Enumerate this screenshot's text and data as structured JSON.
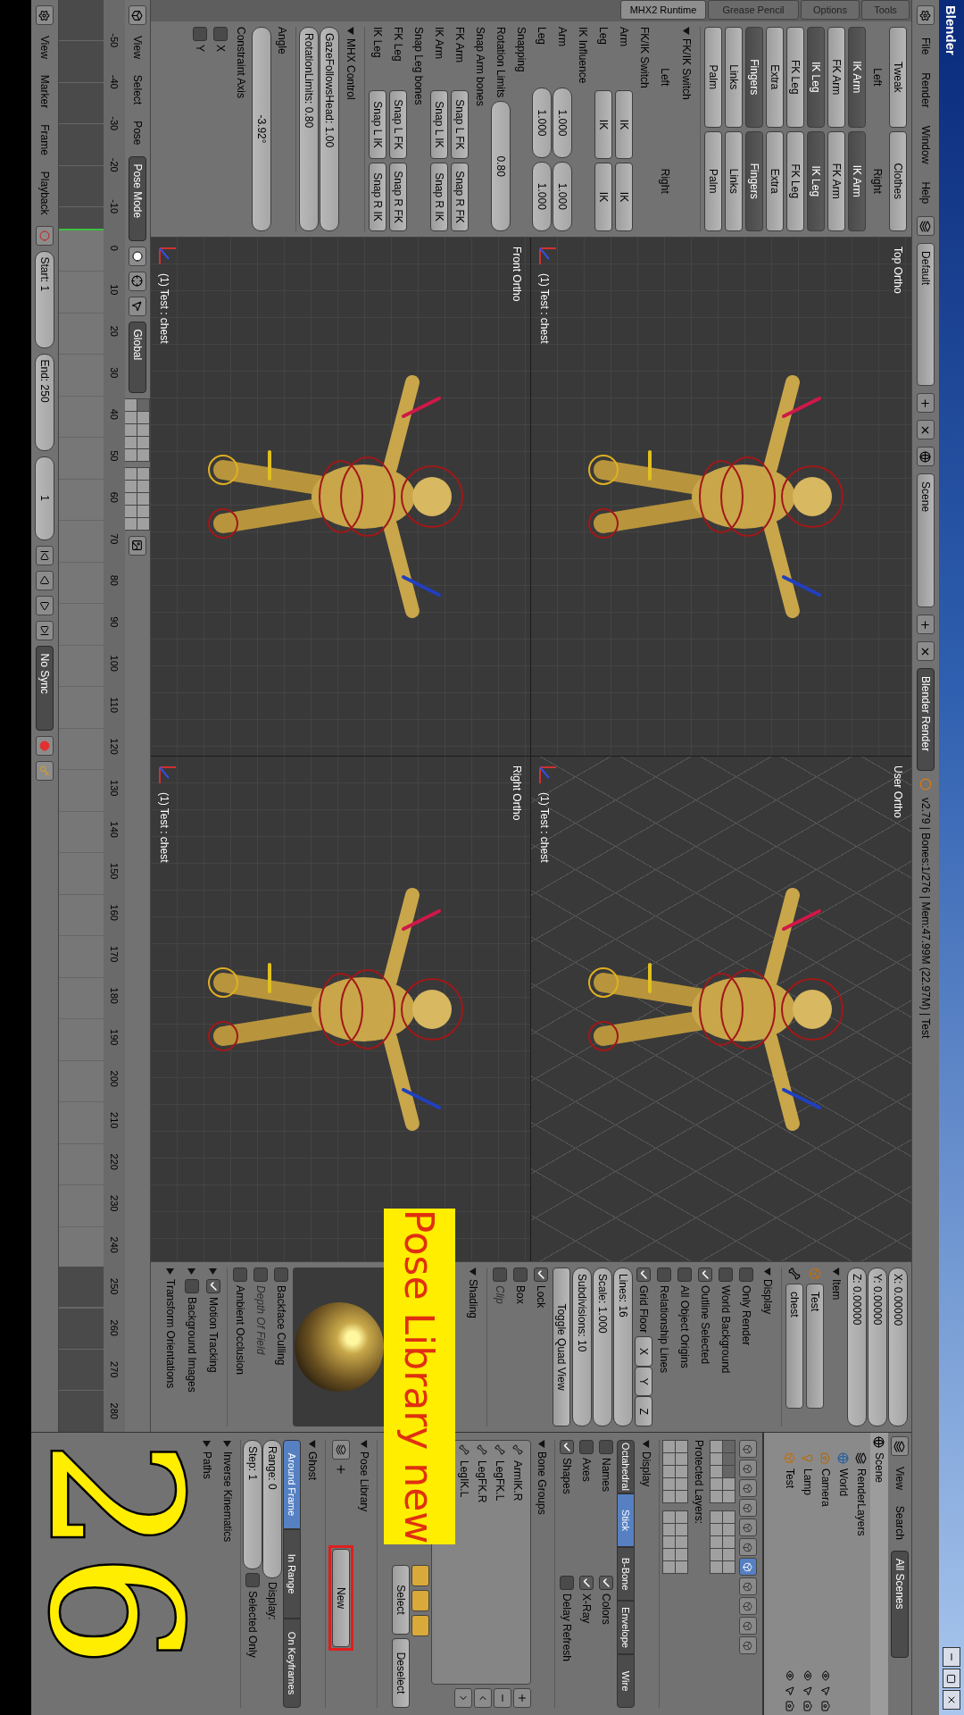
{
  "window": {
    "title": "Blender"
  },
  "info_header": {
    "menus": [
      "File",
      "Render",
      "Window",
      "Help"
    ],
    "layout": "Default",
    "scene": "Scene",
    "engine": "Blender Render",
    "stats": "v2.79 | Bones:1/276 | Mem:47.99M (22.97M) | Test"
  },
  "tool_shelf": {
    "tabs": [
      {
        "label": "MHX2 Runtime",
        "selected": true
      },
      {
        "label": "Grease Pencil",
        "selected": false
      },
      {
        "label": "Options",
        "selected": false
      },
      {
        "label": "Tools",
        "selected": false
      }
    ],
    "top_row": [
      {
        "label": "Tweak",
        "on": false
      },
      {
        "label": "Clothes",
        "on": false
      }
    ],
    "column_labels": [
      "Left",
      "Right"
    ],
    "layer_rows": [
      [
        {
          "label": "IK Arm",
          "on": true
        },
        {
          "label": "IK Arm",
          "on": true
        }
      ],
      [
        {
          "label": "FK Arm",
          "on": false
        },
        {
          "label": "FK Arm",
          "on": false
        }
      ],
      [
        {
          "label": "IK Leg",
          "on": true
        },
        {
          "label": "IK Leg",
          "on": true
        }
      ],
      [
        {
          "label": "FK Leg",
          "on": false
        },
        {
          "label": "FK Leg",
          "on": false
        }
      ],
      [
        {
          "label": "Extra",
          "on": false
        },
        {
          "label": "Extra",
          "on": false
        }
      ],
      [
        {
          "label": "Fingers",
          "on": true
        },
        {
          "label": "Fingers",
          "on": true
        }
      ],
      [
        {
          "label": "Links",
          "on": false
        },
        {
          "label": "Links",
          "on": false
        }
      ],
      [
        {
          "label": "Palm",
          "on": false
        },
        {
          "label": "Palm",
          "on": false
        }
      ]
    ],
    "panels": [
      {
        "title": "FK/IK Switch",
        "expanded": true,
        "rows": [
          {
            "kind": "columns",
            "values": [
              "Left",
              "Right"
            ]
          },
          {
            "kind": "heading",
            "text": "FK/IK Switch"
          },
          {
            "kind": "buttons",
            "label": "Arm",
            "values": [
              "IK",
              "IK"
            ]
          },
          {
            "kind": "buttons",
            "label": "Leg",
            "values": [
              "IK",
              "IK"
            ]
          },
          {
            "kind": "heading",
            "text": "IK Influence"
          },
          {
            "kind": "numbers",
            "label": "Arm",
            "values": [
              "1.000",
              "1.000"
            ]
          },
          {
            "kind": "numbers",
            "label": "Leg",
            "values": [
              "1.000",
              "1.000"
            ]
          },
          {
            "kind": "heading",
            "text": "Snapping"
          },
          {
            "kind": "field",
            "label": "Rotation Limits",
            "values": [
              "0.80"
            ]
          },
          {
            "kind": "heading",
            "text": "Snap Arm bones"
          },
          {
            "kind": "buttons",
            "label": "FK Arm",
            "values": [
              "Snap L FK",
              "Snap R FK"
            ]
          },
          {
            "kind": "buttons",
            "label": "IK Arm",
            "values": [
              "Snap L IK",
              "Snap R IK"
            ]
          },
          {
            "kind": "heading",
            "text": "Snap Leg bones"
          },
          {
            "kind": "buttons",
            "label": "FK Leg",
            "values": [
              "Snap L FK",
              "Snap R FK"
            ]
          },
          {
            "kind": "buttons",
            "label": "IK Leg",
            "values": [
              "Snap L IK",
              "Snap R IK"
            ]
          }
        ]
      },
      {
        "title": "MHX Control",
        "expanded": true,
        "rows": [
          {
            "kind": "labeled",
            "label": "GazeFollowsHead:",
            "values": [
              "1.00"
            ]
          },
          {
            "kind": "labeled",
            "label": "RotationLimits:",
            "values": [
              "0.80"
            ]
          }
        ]
      }
    ],
    "operator": {
      "angle_label": "Angle",
      "angle": "-3.92°",
      "constraint_label": "Constraint Axis",
      "axes": [
        {
          "label": "X",
          "checked": false
        },
        {
          "label": "Y",
          "checked": false
        }
      ]
    }
  },
  "viewports": [
    {
      "view": "Top Ortho",
      "object": "(1) Test : chest",
      "diagonal_grid": false
    },
    {
      "view": "User Ortho",
      "object": "(1) Test : chest",
      "diagonal_grid": true
    },
    {
      "view": "Front Ortho",
      "object": "(1) Test : chest",
      "diagonal_grid": false
    },
    {
      "view": "Right Ortho",
      "object": "(1) Test : chest",
      "diagonal_grid": false
    }
  ],
  "view3d_header": {
    "menus": [
      "View",
      "Select",
      "Pose"
    ],
    "mode": "Pose Mode",
    "orientation": "Global"
  },
  "n_panel": {
    "transform": [
      {
        "label": "X:",
        "value": "0.00000"
      },
      {
        "label": "Y:",
        "value": "0.00000"
      },
      {
        "label": "Z:",
        "value": "0.00000"
      }
    ],
    "item": {
      "title": "Item",
      "expanded": true,
      "object": "Test",
      "bone": "chest"
    },
    "display": {
      "title": "Display",
      "expanded": true,
      "checks": [
        {
          "label": "Only Render",
          "checked": false,
          "disabled": false
        },
        {
          "label": "World Background",
          "checked": false,
          "disabled": false
        },
        {
          "label": "Outline Selected",
          "checked": true,
          "disabled": false
        },
        {
          "label": "All Object Origins",
          "checked": false,
          "disabled": false
        },
        {
          "label": "Relationship Lines",
          "checked": false,
          "disabled": false
        }
      ],
      "grid_floor": {
        "label": "Grid Floor",
        "checked": true,
        "axes": [
          "X",
          "Y",
          "Z"
        ]
      },
      "fields": [
        {
          "label": "Lines:",
          "value": "16"
        },
        {
          "label": "Scale:",
          "value": "1.000"
        },
        {
          "label": "Subdivisions:",
          "value": "10"
        }
      ],
      "quad_button": "Toggle Quad View",
      "quad_checks": [
        {
          "label": "Lock",
          "checked": true,
          "disabled": false
        },
        {
          "label": "Box",
          "checked": false,
          "disabled": false
        },
        {
          "label": "Clip",
          "checked": false,
          "disabled": true
        }
      ]
    },
    "shading": {
      "title": "Shading",
      "expanded": true,
      "checks": [
        {
          "label": "Backface Culling",
          "checked": false,
          "disabled": false
        },
        {
          "label": "Depth Of Field",
          "checked": false,
          "disabled": true
        },
        {
          "label": "Ambient Occlusion",
          "checked": false,
          "disabled": false
        }
      ]
    },
    "collapsed": [
      {
        "title": "Motion Tracking",
        "expanded": false,
        "checked": true,
        "kind": "check"
      },
      {
        "title": "Background Images",
        "expanded": false,
        "checked": false,
        "kind": "check"
      },
      {
        "title": "Transform Orientations",
        "expanded": false,
        "kind": "plain"
      }
    ]
  },
  "outliner": {
    "menus": [
      "View",
      "Search"
    ],
    "filter": "All Scenes",
    "tree": [
      {
        "label": "Scene",
        "children": [
          {
            "label": "RenderLayers"
          },
          {
            "label": "World"
          },
          {
            "label": "Camera"
          },
          {
            "label": "Lamp"
          },
          {
            "label": "Test"
          }
        ]
      }
    ]
  },
  "properties": {
    "context_tabs": [
      {
        "selected": false
      },
      {
        "selected": false
      },
      {
        "selected": false
      },
      {
        "selected": false
      },
      {
        "selected": false
      },
      {
        "selected": false
      },
      {
        "selected": true
      },
      {
        "selected": false
      },
      {
        "selected": false
      },
      {
        "selected": false
      },
      {
        "selected": false
      }
    ],
    "protected_label": "Protected Layers:",
    "display": {
      "title": "Display",
      "expanded": true,
      "modes": [
        {
          "label": "Octahedral",
          "selected": false
        },
        {
          "label": "Stick",
          "selected": true
        },
        {
          "label": "B-Bone",
          "selected": false
        },
        {
          "label": "Envelope",
          "selected": false
        },
        {
          "label": "Wire",
          "selected": false
        }
      ],
      "checks": [
        {
          "label": "Names",
          "checked": false
        },
        {
          "label": "Colors",
          "checked": true
        },
        {
          "label": "Axes",
          "checked": false
        },
        {
          "label": "X-Ray",
          "checked": true
        },
        {
          "label": "Shapes",
          "checked": true
        },
        {
          "label": "Delay Refresh",
          "checked": false
        }
      ]
    },
    "bone_groups": {
      "title": "Bone Groups",
      "expanded": true,
      "items": [
        "ArmIK.R",
        "LegFK.L",
        "LegFK.R",
        "LegIK.L"
      ],
      "actions": [
        "Select",
        "Deselect"
      ]
    },
    "pose_library": {
      "title": "Pose Library",
      "expanded": true,
      "button": "New"
    },
    "ghost": {
      "title": "Ghost",
      "expanded": true,
      "modes": [
        {
          "label": "Around Frame",
          "selected": true
        },
        {
          "label": "In Range",
          "selected": false
        },
        {
          "label": "On Keyframes",
          "selected": false
        }
      ],
      "fields": [
        {
          "label": "Range:",
          "value": "0"
        },
        {
          "label": "Step:",
          "value": "1"
        }
      ],
      "display_label": "Display:",
      "selected_only": {
        "label": "Selected Only",
        "checked": false
      }
    },
    "collapsed": [
      {
        "title": "Inverse Kinematics",
        "expanded": false
      },
      {
        "title": "Paths",
        "expanded": false
      }
    ]
  },
  "timeline": {
    "ticks": [
      "-50",
      "-40",
      "-30",
      "-20",
      "-10",
      "0",
      "10",
      "20",
      "30",
      "40",
      "50",
      "60",
      "70",
      "80",
      "90",
      "100",
      "110",
      "120",
      "130",
      "140",
      "150",
      "160",
      "170",
      "180",
      "190",
      "200",
      "210",
      "220",
      "230",
      "240",
      "250",
      "260",
      "270",
      "280"
    ],
    "menus": [
      "View",
      "Marker",
      "Frame",
      "Playback"
    ],
    "start": {
      "label": "Start:",
      "value": "1"
    },
    "end": {
      "label": "End:",
      "value": "250"
    },
    "current": "1",
    "sync": "No Sync"
  },
  "overlays": {
    "caption": "Pose Library new",
    "episode": "26"
  }
}
